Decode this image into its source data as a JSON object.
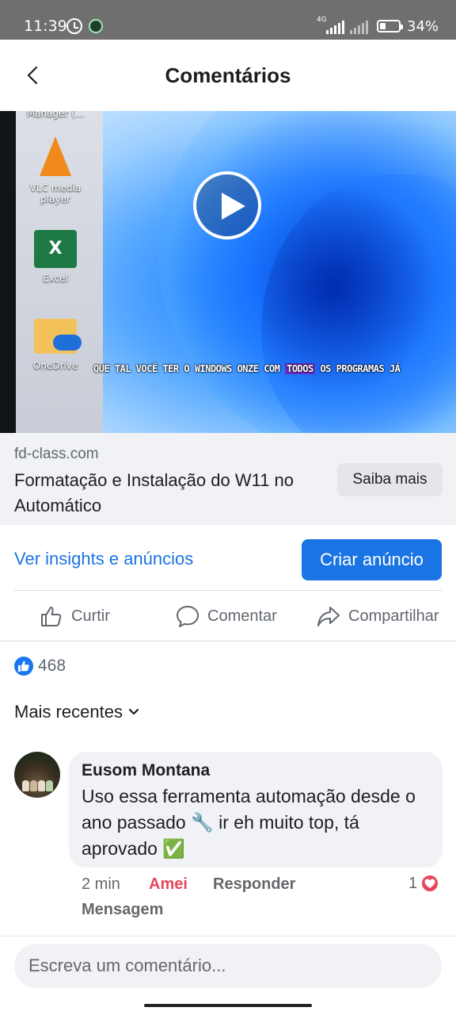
{
  "status_bar": {
    "time": "11:39",
    "network": "4G",
    "battery": "34%",
    "battery_level": 0.34
  },
  "header": {
    "title": "Comentários"
  },
  "video": {
    "desktop_icons": {
      "manager": "Manager (...",
      "vlc": "VLC media player",
      "excel_glyph": "X",
      "excel": "Excel",
      "onedrive": "OneDrive"
    },
    "caption_before": "QUE TAL VOCÊ TER O WINDOWS ONZE COM ",
    "caption_highlight": "TODOS",
    "caption_after": " OS PROGRAMAS JÁ"
  },
  "link_preview": {
    "domain": "fd-class.com",
    "headline": "Formatação e Instalação do W11 no Automático",
    "cta": "Saiba mais"
  },
  "promo": {
    "insights_link": "Ver insights e anúncios",
    "create_ad": "Criar anúncio"
  },
  "actions": {
    "like": "Curtir",
    "comment": "Comentar",
    "share": "Compartilhar"
  },
  "reactions": {
    "count": "468"
  },
  "sort": {
    "label": "Mais recentes"
  },
  "comments": [
    {
      "author": "Eusom Montana",
      "text": "Uso essa ferramenta automação desde o ano passado 🔧 ir eh muito top, tá aprovado ✅",
      "time": "2 min",
      "reaction": "Amei",
      "reply": "Responder",
      "message": "Mensagem",
      "reaction_count": "1"
    }
  ],
  "composer": {
    "placeholder": "Escreva um comentário..."
  },
  "colors": {
    "accent": "#1b74e4",
    "love": "#e8455b",
    "surface": "#f0f2f5"
  }
}
